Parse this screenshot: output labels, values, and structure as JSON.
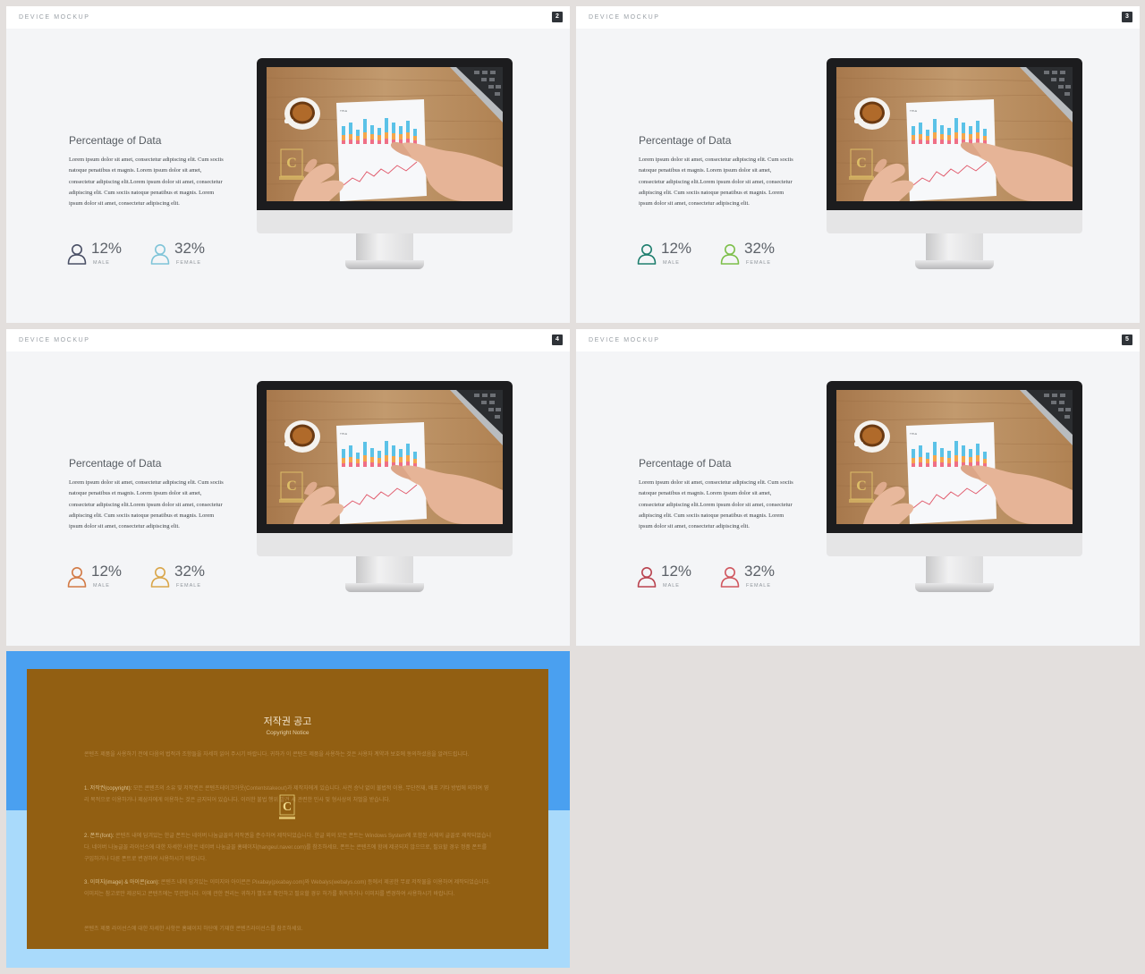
{
  "slides": [
    {
      "section_label": "DEVICE MOCKUP",
      "page_number": "2",
      "title": "Percentage of Data",
      "body": "Lorem ipsum dolor sit amet, consectetur adipiscing elit. Cum sociis natoque penatibus et magnis. Lorem ipsum dolor sit amet, consectetur adipiscing elit.Lorem ipsum dolor sit amet, consectetur adipiscing elit. Cum sociis natoque penatibus et magnis. Lorem ipsum dolor sit amet, consectetur adipiscing elit.",
      "stat_male": {
        "value": "12%",
        "label": "MALE",
        "icon": "person-icon",
        "color": "#4a5066"
      },
      "stat_female": {
        "value": "32%",
        "label": "FEMALE",
        "icon": "person-icon",
        "color": "#7fc4d8"
      }
    },
    {
      "section_label": "DEVICE MOCKUP",
      "page_number": "3",
      "title": "Percentage of Data",
      "body": "Lorem ipsum dolor sit amet, consectetur adipiscing elit. Cum sociis natoque penatibus et magnis. Lorem ipsum dolor sit amet, consectetur adipiscing elit.Lorem ipsum dolor sit amet, consectetur adipiscing elit. Cum sociis natoque penatibus et magnis. Lorem ipsum dolor sit amet, consectetur adipiscing elit.",
      "stat_male": {
        "value": "12%",
        "label": "MALE",
        "icon": "person-icon",
        "color": "#1e7e6e"
      },
      "stat_female": {
        "value": "32%",
        "label": "FEMALE",
        "icon": "person-icon",
        "color": "#7dbf4a"
      }
    },
    {
      "section_label": "DEVICE MOCKUP",
      "page_number": "4",
      "title": "Percentage of Data",
      "body": "Lorem ipsum dolor sit amet, consectetur adipiscing elit. Cum sociis natoque penatibus et magnis. Lorem ipsum dolor sit amet, consectetur adipiscing elit.Lorem ipsum dolor sit amet, consectetur adipiscing elit. Cum sociis natoque penatibus et magnis. Lorem ipsum dolor sit amet, consectetur adipiscing elit.",
      "stat_male": {
        "value": "12%",
        "label": "MALE",
        "icon": "person-icon",
        "color": "#d27a45"
      },
      "stat_female": {
        "value": "32%",
        "label": "FEMALE",
        "icon": "person-icon",
        "color": "#d9a64a"
      }
    },
    {
      "section_label": "DEVICE MOCKUP",
      "page_number": "5",
      "title": "Percentage of Data",
      "body": "Lorem ipsum dolor sit amet, consectetur adipiscing elit. Cum sociis natoque penatibus et magnis. Lorem ipsum dolor sit amet, consectetur adipiscing elit.Lorem ipsum dolor sit amet, consectetur adipiscing elit. Cum sociis natoque penatibus et magnis. Lorem ipsum dolor sit amet, consectetur adipiscing elit.",
      "stat_male": {
        "value": "12%",
        "label": "MALE",
        "icon": "person-icon",
        "color": "#b9434f"
      },
      "stat_female": {
        "value": "32%",
        "label": "FEMALE",
        "icon": "person-icon",
        "color": "#d0575f"
      }
    }
  ],
  "copyright": {
    "title": "저작권 공고",
    "subtitle": "Copyright Notice",
    "intro": "콘텐츠 제품을 사용하기 전에 다음의 법적과 조항들을 자세히 읽어 주시기 바랍니다. 귀하가 이 콘텐츠 제품을 사용하는 것은 사용자 계약과 보호에 동의하셨음을 알려드립니다.",
    "item1_label": "1. 저작권(copyright):",
    "item1_text": " 모든 콘텐츠의 소유 및 저작권은 콘텐츠테이크아웃(Contentstakeout)과 제작자에게 있습니다. 사전 승낙 없이 불법적 이용, 무단전재, 배포 기타 방법에 의하여 영리 목적으로 이용하거나 제삼자에게 이용하는 것은 금지되어 있습니다. 이러한 불법 행위 발견 시 관련한 민사 및 형사상의 처벌을 받습니다.",
    "item2_label": "2. 폰트(font):",
    "item2_text": " 콘텐츠 내에 담겨있는 한글 폰트는 네이버 나눔글꼴의 저작권을 준수하여 제작되었습니다. 한글 외의 모든 폰트는 Windows System에 포함된 서체의 글꼴로 제작되었습니다. 네이버 나눔글꼴 라이선스에 대한 자세한 사항은 네이버 나눔글꼴 홈페이지(hangeul.naver.com)를 참조하세요. 폰트는 콘텐츠에 함께 제공되지 않으므로, 필요할 경우 정품 폰트를 구입하거나 다른 폰트로 변경하여 사용하시기 바랍니다.",
    "item3_label": "3. 이미지(image) & 아이콘(icon):",
    "item3_text": " 콘텐츠 내에 담겨있는 이미지와 아이콘은 Pixabay(pixabay.com)와 Webalys(webalys.com) 등에서 제공한 무료 저작물을 이용하여 제작되었습니다. 이미지는 참고로만 제공되고 콘텐츠에는 무관합니다. 이에 관한 권리는 귀하가 별도로 확인하고 필요할 경우 허가를 취득하거나 이미지를 변경하여 사용하시기 바랍니다.",
    "outro": "콘텐츠 제품 라이선스에 대한 자세한 사항은 홈페이지 하단에 기재한 콘텐츠라이선스를 참조하세요."
  },
  "colors": {
    "bar_blue": "#5bc2e7",
    "bar_orange": "#f5a64b",
    "bar_pink": "#ef6f86",
    "line_red": "#e05466",
    "copyright_panel": "#925f12",
    "copyright_bg_top": "#4aa0f0",
    "copyright_bg_bottom": "#a9dafb"
  }
}
